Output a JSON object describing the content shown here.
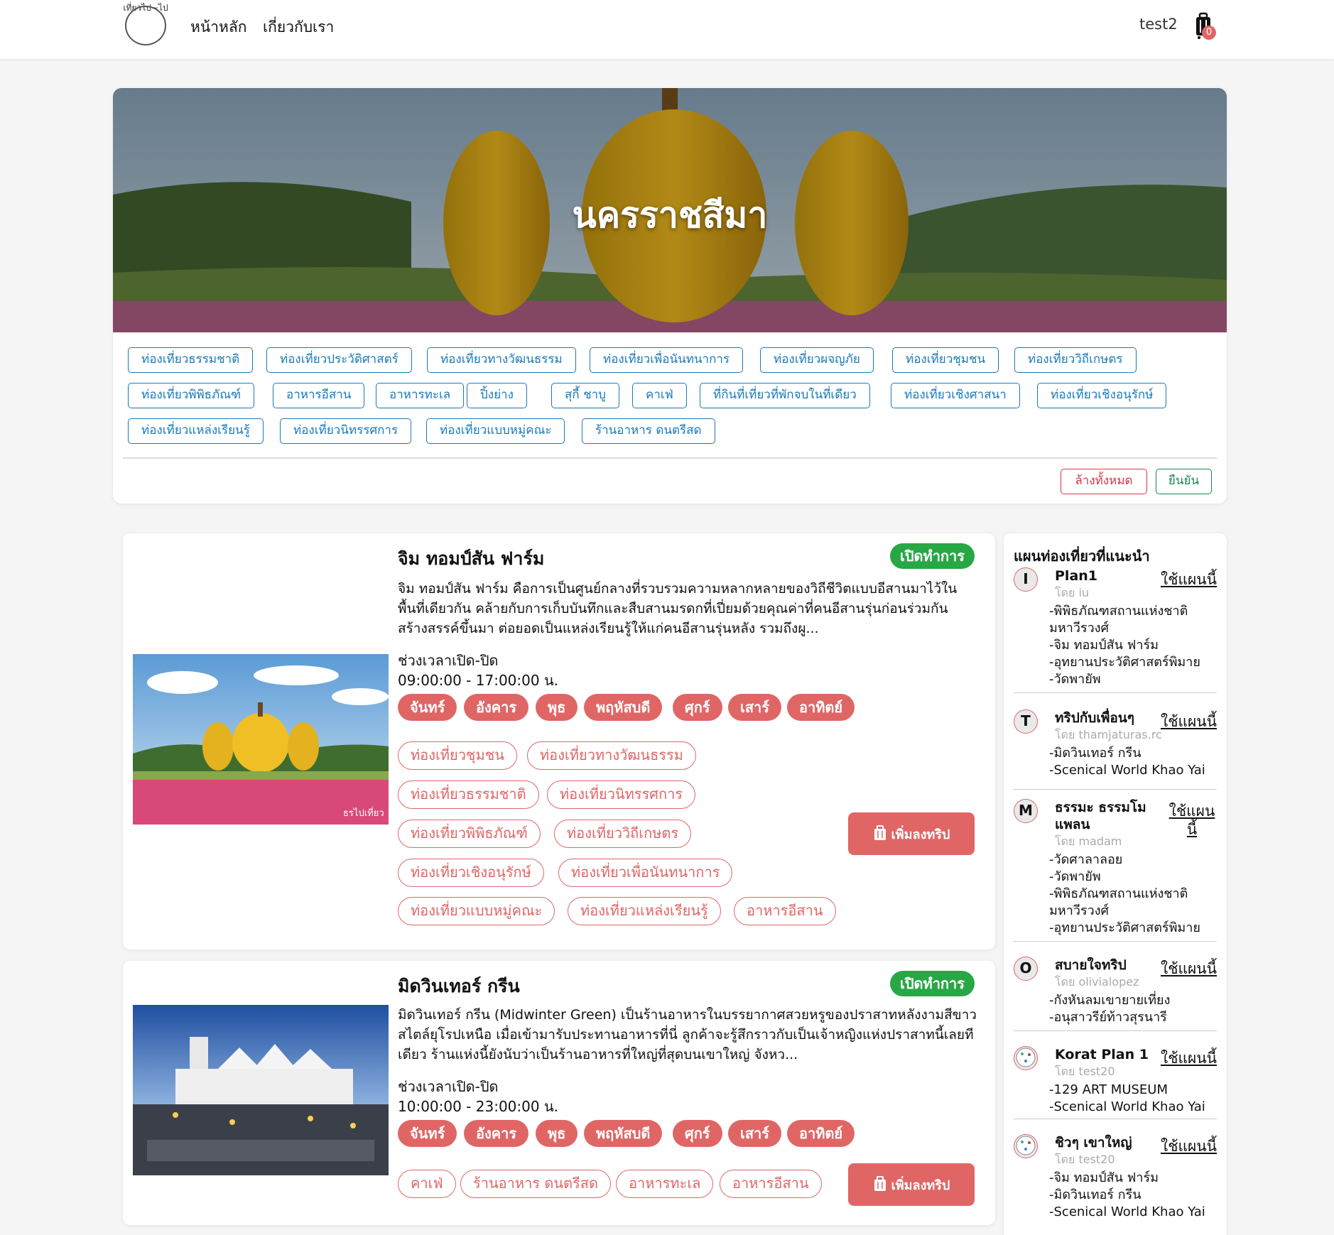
{
  "navbar": {
    "logo_text": "เที่ยวไป~ไป",
    "links": [
      "หน้าหลัก",
      "เกี่ยวกับเรา"
    ],
    "user": "test2",
    "cart_count": "0"
  },
  "hero": {
    "title": "นครราชสีมา"
  },
  "filters": {
    "tags": [
      "ท่องเที่ยวธรรมชาติ",
      "ท่องเที่ยวประวัติศาสตร์",
      "ท่องเที่ยวทางวัฒนธรรม",
      "ท่องเที่ยวเพื่อนันทนาการ",
      "ท่องเที่ยวผจญภัย",
      "ท่องเที่ยวชุมชน",
      "ท่องเที่ยววิถีเกษตร",
      "ท่องเที่ยวพิพิธภัณฑ์",
      "อาหารอีสาน",
      "อาหารทะเล",
      "ปิ้งย่าง",
      "สุกี้ ชาบู",
      "คาเฟ่",
      "ที่กินที่เที่ยวที่พักจบในที่เดียว",
      "ท่องเที่ยวเชิงศาสนา",
      "ท่องเที่ยวเชิงอนุรักษ์",
      "ท่องเที่ยวแหล่งเรียนรู้",
      "ท่องเที่ยวนิทรรศการ",
      "ท่องเที่ยวแบบหมู่คณะ",
      "ร้านอาหาร ดนตรีสด"
    ],
    "clear_label": "ล้างทั้งหมด",
    "confirm_label": "ยืนยัน"
  },
  "places": [
    {
      "title": "จิม ทอมป์สัน ฟาร์ม",
      "status": "เปิดทำการ",
      "description": "จิม ทอมป์สัน ฟาร์ม คือการเป็นศูนย์กลางที่รวบรวมความหลากหลายของวิถีชีวิตแบบอีสานมาไว้ในพื้นที่เดียวกัน คล้ายกับการเก็บบันทึกและสืบสานมรดกที่เปี่ยมด้วยคุณค่าที่คนอีสานรุ่นก่อนร่วมกันสร้างสรรค์ขึ้นมา ต่อยอดเป็นแหล่งเรียนรู้ให้แก่คนอีสานรุ่นหลัง รวมถึงผู...",
      "hours_label": "ช่วงเวลาเปิด-ปิด",
      "hours": "09:00:00 - 17:00:00 น.",
      "days": [
        "จันทร์",
        "อังคาร",
        "พุธ",
        "พฤหัสบดี",
        "ศุกร์",
        "เสาร์",
        "อาทิตย์"
      ],
      "categories": [
        "ท่องเที่ยวชุมชน",
        "ท่องเที่ยวทางวัฒนธรรม",
        "ท่องเที่ยวธรรมชาติ",
        "ท่องเที่ยวนิทรรศการ",
        "ท่องเที่ยวพิพิธภัณฑ์",
        "ท่องเที่ยววิถีเกษตร",
        "ท่องเที่ยวเชิงอนุรักษ์",
        "ท่องเที่ยวเพื่อนันทนาการ",
        "ท่องเที่ยวแบบหมู่คณะ",
        "ท่องเที่ยวแหล่งเรียนรู้",
        "อาหารอีสาน"
      ],
      "add_label": "เพิ่มลงทริป",
      "image_watermark": "ธรไปเที่ยว"
    },
    {
      "title": "มิดวินเทอร์ กรีน",
      "status": "เปิดทำการ",
      "description": "มิดวินเทอร์ กรีน (Midwinter Green) เป็นร้านอาหารในบรรยากาศสวยหรูของปราสาทหลังงามสีขาวสไตล์ยุโรปเหนือ เมื่อเข้ามารับประทานอาหารที่นี่ ลูกค้าจะรู้สึกราวกับเป็นเจ้าหญิงแห่งปราสาทนี้เลยทีเดียว ร้านแห่งนี้ยังนับว่าเป็นร้านอาหารที่ใหญ่ที่สุดบนเขาใหญ่ จังหว...",
      "hours_label": "ช่วงเวลาเปิด-ปิด",
      "hours": "10:00:00 - 23:00:00 น.",
      "days": [
        "จันทร์",
        "อังคาร",
        "พุธ",
        "พฤหัสบดี",
        "ศุกร์",
        "เสาร์",
        "อาทิตย์"
      ],
      "categories": [
        "คาเฟ่",
        "ร้านอาหาร ดนตรีสด",
        "อาหารทะเล",
        "อาหารอีสาน"
      ],
      "add_label": "เพิ่มลงทริป"
    }
  ],
  "sidebar": {
    "title": "แผนท่องเที่ยวที่แนะนำ",
    "use_label": "ใช้แผนนี้",
    "plans": [
      {
        "avatar": "I",
        "name": "Plan1",
        "by": "โดย iu",
        "items": "-พิพิธภัณฑสถานแห่งชาติ\n  มหาวีรวงศ์\n-จิม ทอมป์สัน ฟาร์ม\n-อุทยานประวัติศาสตร์พิมาย\n-วัดพายัพ"
      },
      {
        "avatar": "T",
        "name": "ทริปกับเพื่อนๆ",
        "by": "โดย thamjaturas.rc",
        "items": "-มิดวินเทอร์ กรีน\n-Scenical World Khao Yai"
      },
      {
        "avatar": "M",
        "name": "ธรรมะ ธรรมโม แพลน",
        "by": "โดย madam",
        "items": "-วัดศาลาลอย\n-วัดพายัพ\n-พิพิธภัณฑสถานแห่งชาติ\n  มหาวีรวงศ์\n-อุทยานประวัติศาสตร์พิมาย"
      },
      {
        "avatar": "O",
        "name": "สบายใจทริป",
        "by": "โดย olivialopez",
        "items": "-กังหันลมเขายายเที่ยง\n-อนุสาวรีย์ท้าวสุรนารี"
      },
      {
        "avatar": "",
        "name": "Korat Plan 1",
        "by": "โดย test20",
        "items": "-129 ART MUSEUM\n-Scenical World Khao Yai"
      },
      {
        "avatar": "",
        "name": "ชิวๆ เขาใหญ่",
        "by": "โดย test20",
        "items": "-จิม ทอมป์สัน ฟาร์ม\n-มิดวินเทอร์ กรีน\n-Scenical World Khao Yai"
      }
    ]
  }
}
